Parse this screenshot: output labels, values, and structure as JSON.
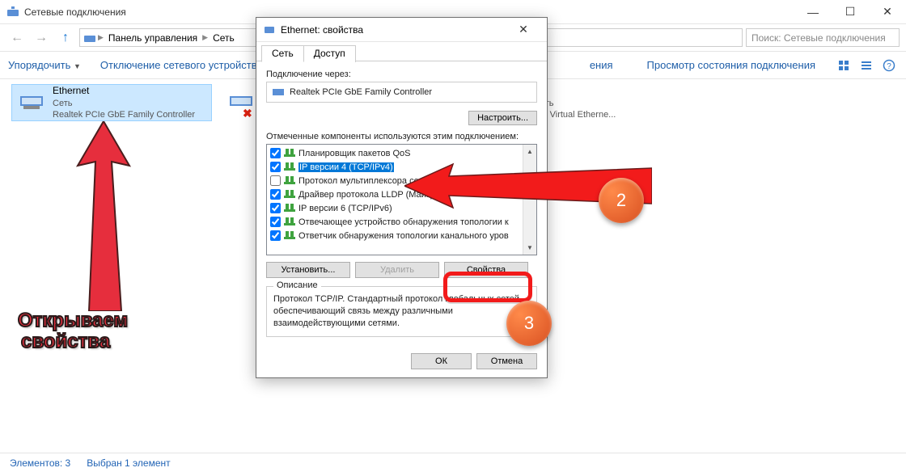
{
  "window": {
    "title": "Сетевые подключения"
  },
  "nav": {
    "back": "←",
    "forward": "→",
    "up": "↑"
  },
  "breadcrumbs": {
    "b0": "Панель управления",
    "b1": "Сеть"
  },
  "search": {
    "placeholder": "Поиск: Сетевые подключения"
  },
  "toolbar": {
    "organize": "Упорядочить",
    "disable": "Отключение сетевого устройства",
    "diagnose": "ения",
    "rename": "Просмотр состояния подключения"
  },
  "connections": {
    "eth": {
      "name": "Ethernet",
      "line2": "Сеть",
      "line3": "Realtek PCIe GbE Family Controller"
    },
    "other1": {
      "line2": "еть",
      "line3": "ni Virtual Etherne..."
    }
  },
  "statusbar": {
    "count": "Элементов: 3",
    "selection": "Выбран 1 элемент"
  },
  "dialog": {
    "title": "Ethernet: свойства",
    "tabs": {
      "t1": "Сеть",
      "t2": "Доступ"
    },
    "connect_via": "Подключение через:",
    "adapter": "Realtek PCIe GbE Family Controller",
    "configure": "Настроить...",
    "components_label": "Отмеченные компоненты используются этим подключением:",
    "components": [
      {
        "checked": true,
        "label": "Планировщик пакетов QoS"
      },
      {
        "checked": true,
        "label": "IP версии 4 (TCP/IPv4)",
        "selected": true
      },
      {
        "checked": false,
        "label": "Протокол мультиплексора се"
      },
      {
        "checked": true,
        "label": "Драйвер протокола LLDP (Майкро      т)"
      },
      {
        "checked": true,
        "label": "IP версии 6 (TCP/IPv6)"
      },
      {
        "checked": true,
        "label": "Отвечающее устройство обнаружения топологии к"
      },
      {
        "checked": true,
        "label": "Ответчик обнаружения топологии канального уров"
      }
    ],
    "install": "Установить...",
    "remove": "Удалить",
    "properties": "Свойства",
    "desc_title": "Описание",
    "desc": "Протокол TCP/IP. Стандартный протокол глобальных сетей, обеспечивающий связь между различными взаимодействующими сетями.",
    "ok": "ОК",
    "cancel": "Отмена"
  },
  "annotations": {
    "open_props_l1": "Открываем",
    "open_props_l2": "свойства",
    "badge2": "2",
    "badge3": "3"
  }
}
